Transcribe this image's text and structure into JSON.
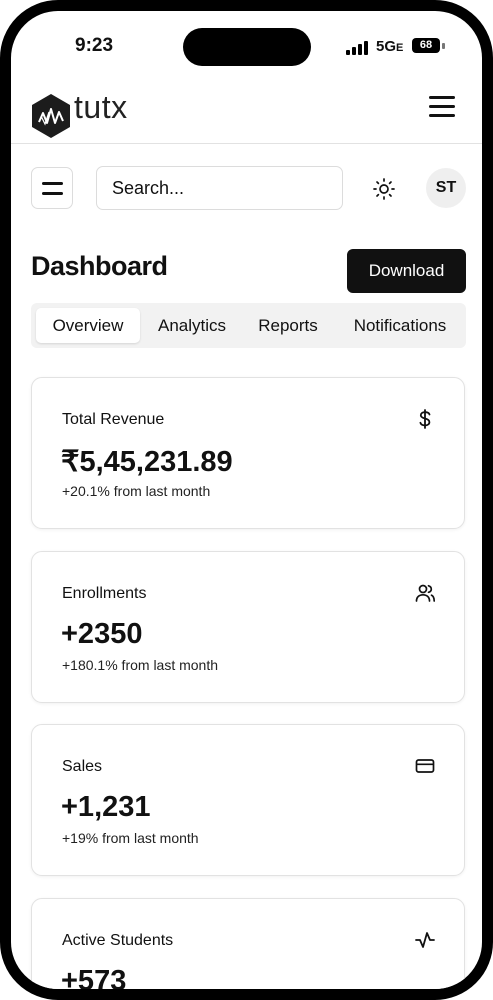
{
  "status_bar": {
    "time": "9:23",
    "network": "5G",
    "network_suffix": "E",
    "battery": "68"
  },
  "header": {
    "logo_text": "tutx"
  },
  "toolbar": {
    "search_placeholder": "Search...",
    "avatar_initials": "ST"
  },
  "page": {
    "title": "Dashboard",
    "download_label": "Download"
  },
  "tabs": [
    {
      "label": "Overview",
      "active": true
    },
    {
      "label": "Analytics",
      "active": false
    },
    {
      "label": "Reports",
      "active": false
    },
    {
      "label": "Notifications",
      "active": false
    }
  ],
  "cards": [
    {
      "label": "Total Revenue",
      "value": "₹5,45,231.89",
      "note": "+20.1% from last month",
      "icon": "dollar-icon"
    },
    {
      "label": "Enrollments",
      "value": "+2350",
      "note": "+180.1% from last month",
      "icon": "users-icon"
    },
    {
      "label": "Sales",
      "value": "+1,231",
      "note": "+19% from last month",
      "icon": "credit-card-icon"
    },
    {
      "label": "Active Students",
      "value": "+573",
      "note": "",
      "icon": "activity-icon"
    }
  ]
}
